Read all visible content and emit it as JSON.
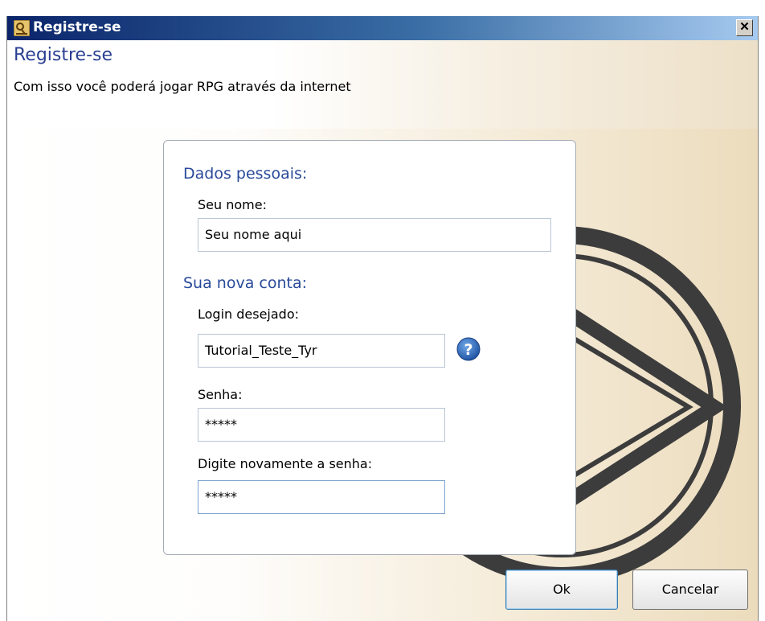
{
  "window": {
    "title": "Registre-se",
    "close_glyph": "✕"
  },
  "header": {
    "title": "Registre-se",
    "subtitle": "Com isso você poderá jogar RPG através da internet"
  },
  "personal": {
    "section_title": "Dados pessoais:",
    "name_label": "Seu nome:",
    "name_value": "Seu nome aqui"
  },
  "account": {
    "section_title": "Sua nova conta:",
    "login_label": "Login desejado:",
    "login_value": "Tutorial_Teste_Tyr",
    "password_label": "Senha:",
    "password_value": "*****",
    "confirm_label": "Digite novamente a senha:",
    "confirm_value": "*****"
  },
  "buttons": {
    "ok": "Ok",
    "cancel": "Cancelar"
  },
  "icons": {
    "app": "rpg-app-icon",
    "help": "question-icon",
    "close": "close-icon"
  },
  "colors": {
    "accent_blue": "#2a4a9a",
    "titlebar_start": "#0a246a",
    "titlebar_end": "#a6caf0"
  }
}
